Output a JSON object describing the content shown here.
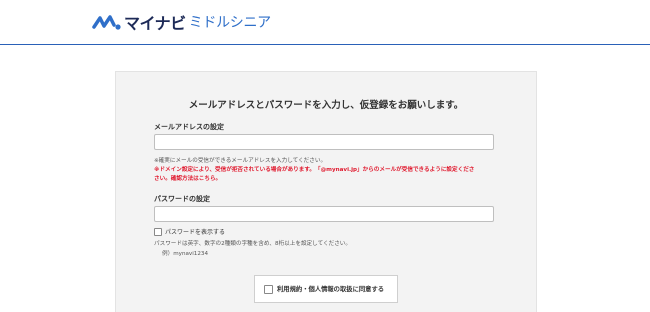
{
  "header": {
    "logo_main": "マイナビ",
    "logo_sub": "ミドルシニア"
  },
  "form": {
    "headline": "メールアドレスとパスワードを入力し、仮登録をお願いします。",
    "email": {
      "label": "メールアドレスの設定",
      "value": "",
      "note": "※確実にメールの受信ができるメールアドレスを入力してください。",
      "warning_line1": "※ドメイン設定により、受信が拒否されている場合があります。「@mynavi.jp」からのメールが受信できるように設定くださ",
      "warning_line2": "さい。確認方法はこちら。"
    },
    "password": {
      "label": "パスワードの設定",
      "value": "",
      "show_label": "パスワードを表示する",
      "note": "パスワードは英字、数字の2種類の字種を含め、8桁以上を設定してください。",
      "example": "例）mynavi1234"
    },
    "agree_label": "利用規約・個人情報の取扱に同意する"
  },
  "colors": {
    "accent_blue": "#2a61b8",
    "warning_red": "#e0182d"
  }
}
